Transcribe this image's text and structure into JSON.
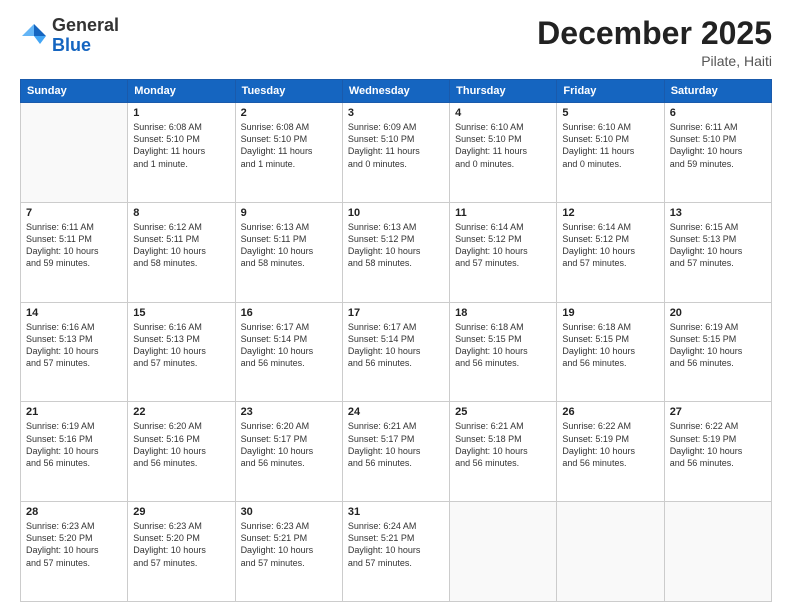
{
  "header": {
    "logo_general": "General",
    "logo_blue": "Blue",
    "month": "December 2025",
    "location": "Pilate, Haiti"
  },
  "days_of_week": [
    "Sunday",
    "Monday",
    "Tuesday",
    "Wednesday",
    "Thursday",
    "Friday",
    "Saturday"
  ],
  "weeks": [
    [
      {
        "day": "",
        "info": ""
      },
      {
        "day": "1",
        "info": "Sunrise: 6:08 AM\nSunset: 5:10 PM\nDaylight: 11 hours\nand 1 minute."
      },
      {
        "day": "2",
        "info": "Sunrise: 6:08 AM\nSunset: 5:10 PM\nDaylight: 11 hours\nand 1 minute."
      },
      {
        "day": "3",
        "info": "Sunrise: 6:09 AM\nSunset: 5:10 PM\nDaylight: 11 hours\nand 0 minutes."
      },
      {
        "day": "4",
        "info": "Sunrise: 6:10 AM\nSunset: 5:10 PM\nDaylight: 11 hours\nand 0 minutes."
      },
      {
        "day": "5",
        "info": "Sunrise: 6:10 AM\nSunset: 5:10 PM\nDaylight: 11 hours\nand 0 minutes."
      },
      {
        "day": "6",
        "info": "Sunrise: 6:11 AM\nSunset: 5:10 PM\nDaylight: 10 hours\nand 59 minutes."
      }
    ],
    [
      {
        "day": "7",
        "info": "Sunrise: 6:11 AM\nSunset: 5:11 PM\nDaylight: 10 hours\nand 59 minutes."
      },
      {
        "day": "8",
        "info": "Sunrise: 6:12 AM\nSunset: 5:11 PM\nDaylight: 10 hours\nand 58 minutes."
      },
      {
        "day": "9",
        "info": "Sunrise: 6:13 AM\nSunset: 5:11 PM\nDaylight: 10 hours\nand 58 minutes."
      },
      {
        "day": "10",
        "info": "Sunrise: 6:13 AM\nSunset: 5:12 PM\nDaylight: 10 hours\nand 58 minutes."
      },
      {
        "day": "11",
        "info": "Sunrise: 6:14 AM\nSunset: 5:12 PM\nDaylight: 10 hours\nand 57 minutes."
      },
      {
        "day": "12",
        "info": "Sunrise: 6:14 AM\nSunset: 5:12 PM\nDaylight: 10 hours\nand 57 minutes."
      },
      {
        "day": "13",
        "info": "Sunrise: 6:15 AM\nSunset: 5:13 PM\nDaylight: 10 hours\nand 57 minutes."
      }
    ],
    [
      {
        "day": "14",
        "info": "Sunrise: 6:16 AM\nSunset: 5:13 PM\nDaylight: 10 hours\nand 57 minutes."
      },
      {
        "day": "15",
        "info": "Sunrise: 6:16 AM\nSunset: 5:13 PM\nDaylight: 10 hours\nand 57 minutes."
      },
      {
        "day": "16",
        "info": "Sunrise: 6:17 AM\nSunset: 5:14 PM\nDaylight: 10 hours\nand 56 minutes."
      },
      {
        "day": "17",
        "info": "Sunrise: 6:17 AM\nSunset: 5:14 PM\nDaylight: 10 hours\nand 56 minutes."
      },
      {
        "day": "18",
        "info": "Sunrise: 6:18 AM\nSunset: 5:15 PM\nDaylight: 10 hours\nand 56 minutes."
      },
      {
        "day": "19",
        "info": "Sunrise: 6:18 AM\nSunset: 5:15 PM\nDaylight: 10 hours\nand 56 minutes."
      },
      {
        "day": "20",
        "info": "Sunrise: 6:19 AM\nSunset: 5:15 PM\nDaylight: 10 hours\nand 56 minutes."
      }
    ],
    [
      {
        "day": "21",
        "info": "Sunrise: 6:19 AM\nSunset: 5:16 PM\nDaylight: 10 hours\nand 56 minutes."
      },
      {
        "day": "22",
        "info": "Sunrise: 6:20 AM\nSunset: 5:16 PM\nDaylight: 10 hours\nand 56 minutes."
      },
      {
        "day": "23",
        "info": "Sunrise: 6:20 AM\nSunset: 5:17 PM\nDaylight: 10 hours\nand 56 minutes."
      },
      {
        "day": "24",
        "info": "Sunrise: 6:21 AM\nSunset: 5:17 PM\nDaylight: 10 hours\nand 56 minutes."
      },
      {
        "day": "25",
        "info": "Sunrise: 6:21 AM\nSunset: 5:18 PM\nDaylight: 10 hours\nand 56 minutes."
      },
      {
        "day": "26",
        "info": "Sunrise: 6:22 AM\nSunset: 5:19 PM\nDaylight: 10 hours\nand 56 minutes."
      },
      {
        "day": "27",
        "info": "Sunrise: 6:22 AM\nSunset: 5:19 PM\nDaylight: 10 hours\nand 56 minutes."
      }
    ],
    [
      {
        "day": "28",
        "info": "Sunrise: 6:23 AM\nSunset: 5:20 PM\nDaylight: 10 hours\nand 57 minutes."
      },
      {
        "day": "29",
        "info": "Sunrise: 6:23 AM\nSunset: 5:20 PM\nDaylight: 10 hours\nand 57 minutes."
      },
      {
        "day": "30",
        "info": "Sunrise: 6:23 AM\nSunset: 5:21 PM\nDaylight: 10 hours\nand 57 minutes."
      },
      {
        "day": "31",
        "info": "Sunrise: 6:24 AM\nSunset: 5:21 PM\nDaylight: 10 hours\nand 57 minutes."
      },
      {
        "day": "",
        "info": ""
      },
      {
        "day": "",
        "info": ""
      },
      {
        "day": "",
        "info": ""
      }
    ]
  ]
}
